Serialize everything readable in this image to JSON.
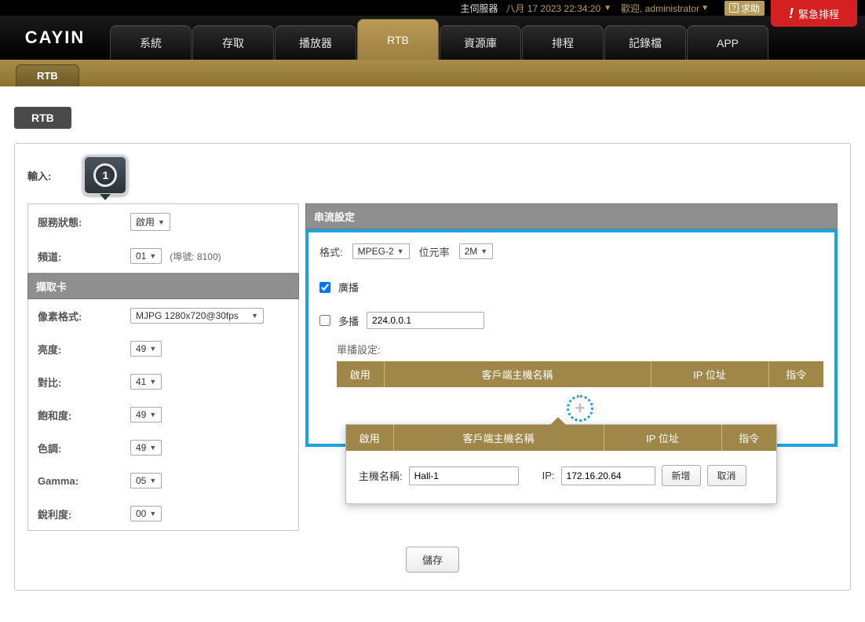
{
  "topbar": {
    "server_label": "主伺服器",
    "datetime": "八月 17 2023 22:34:20",
    "welcome_prefix": "歡迎, ",
    "username": "administrator",
    "help_label": "求助"
  },
  "emergency": {
    "label": "緊急排程"
  },
  "logo": "CAYIN",
  "nav": {
    "items": [
      {
        "label": "系統"
      },
      {
        "label": "存取"
      },
      {
        "label": "播放器"
      },
      {
        "label": "RTB",
        "active": true
      },
      {
        "label": "資源庫"
      },
      {
        "label": "排程"
      },
      {
        "label": "記錄檔"
      },
      {
        "label": "APP"
      }
    ]
  },
  "subnav": {
    "items": [
      {
        "label": "RTB"
      }
    ]
  },
  "page": {
    "title": "RTB"
  },
  "input": {
    "label": "輸入:",
    "number": "1"
  },
  "service": {
    "status_label": "服務狀態:",
    "status_value": "啟用",
    "channel_label": "頻道:",
    "channel_value": "01",
    "port_hint": "(埠號: 8100)"
  },
  "capture": {
    "header": "擷取卡",
    "pixel_format_label": "像素格式:",
    "pixel_format_value": "MJPG 1280x720@30fps",
    "brightness_label": "亮度:",
    "brightness_value": "49",
    "contrast_label": "對比:",
    "contrast_value": "41",
    "saturation_label": "飽和度:",
    "saturation_value": "49",
    "hue_label": "色調:",
    "hue_value": "49",
    "gamma_label": "Gamma:",
    "gamma_value": "05",
    "sharpness_label": "銳利度:",
    "sharpness_value": "00"
  },
  "stream": {
    "header": "串流設定",
    "format_label": "格式:",
    "format_value": "MPEG-2",
    "bitrate_label": "位元率",
    "bitrate_value": "2M",
    "broadcast_label": "廣播",
    "multicast_label": "多播",
    "multicast_ip": "224.0.0.1",
    "unicast_title": "單播設定:",
    "cols": {
      "enable": "啟用",
      "host": "客戶端主機名稱",
      "ip": "IP 位址",
      "cmd": "指令"
    }
  },
  "popup": {
    "cols": {
      "enable": "啟用",
      "host": "客戶端主機名稱",
      "ip": "IP 位址",
      "cmd": "指令"
    },
    "hostname_label": "主機名稱:",
    "hostname_value": "Hall-1",
    "ip_label": "IP:",
    "ip_value": "172.16.20.64",
    "add_btn": "新增",
    "cancel_btn": "取消"
  },
  "save": {
    "label": "儲存"
  }
}
